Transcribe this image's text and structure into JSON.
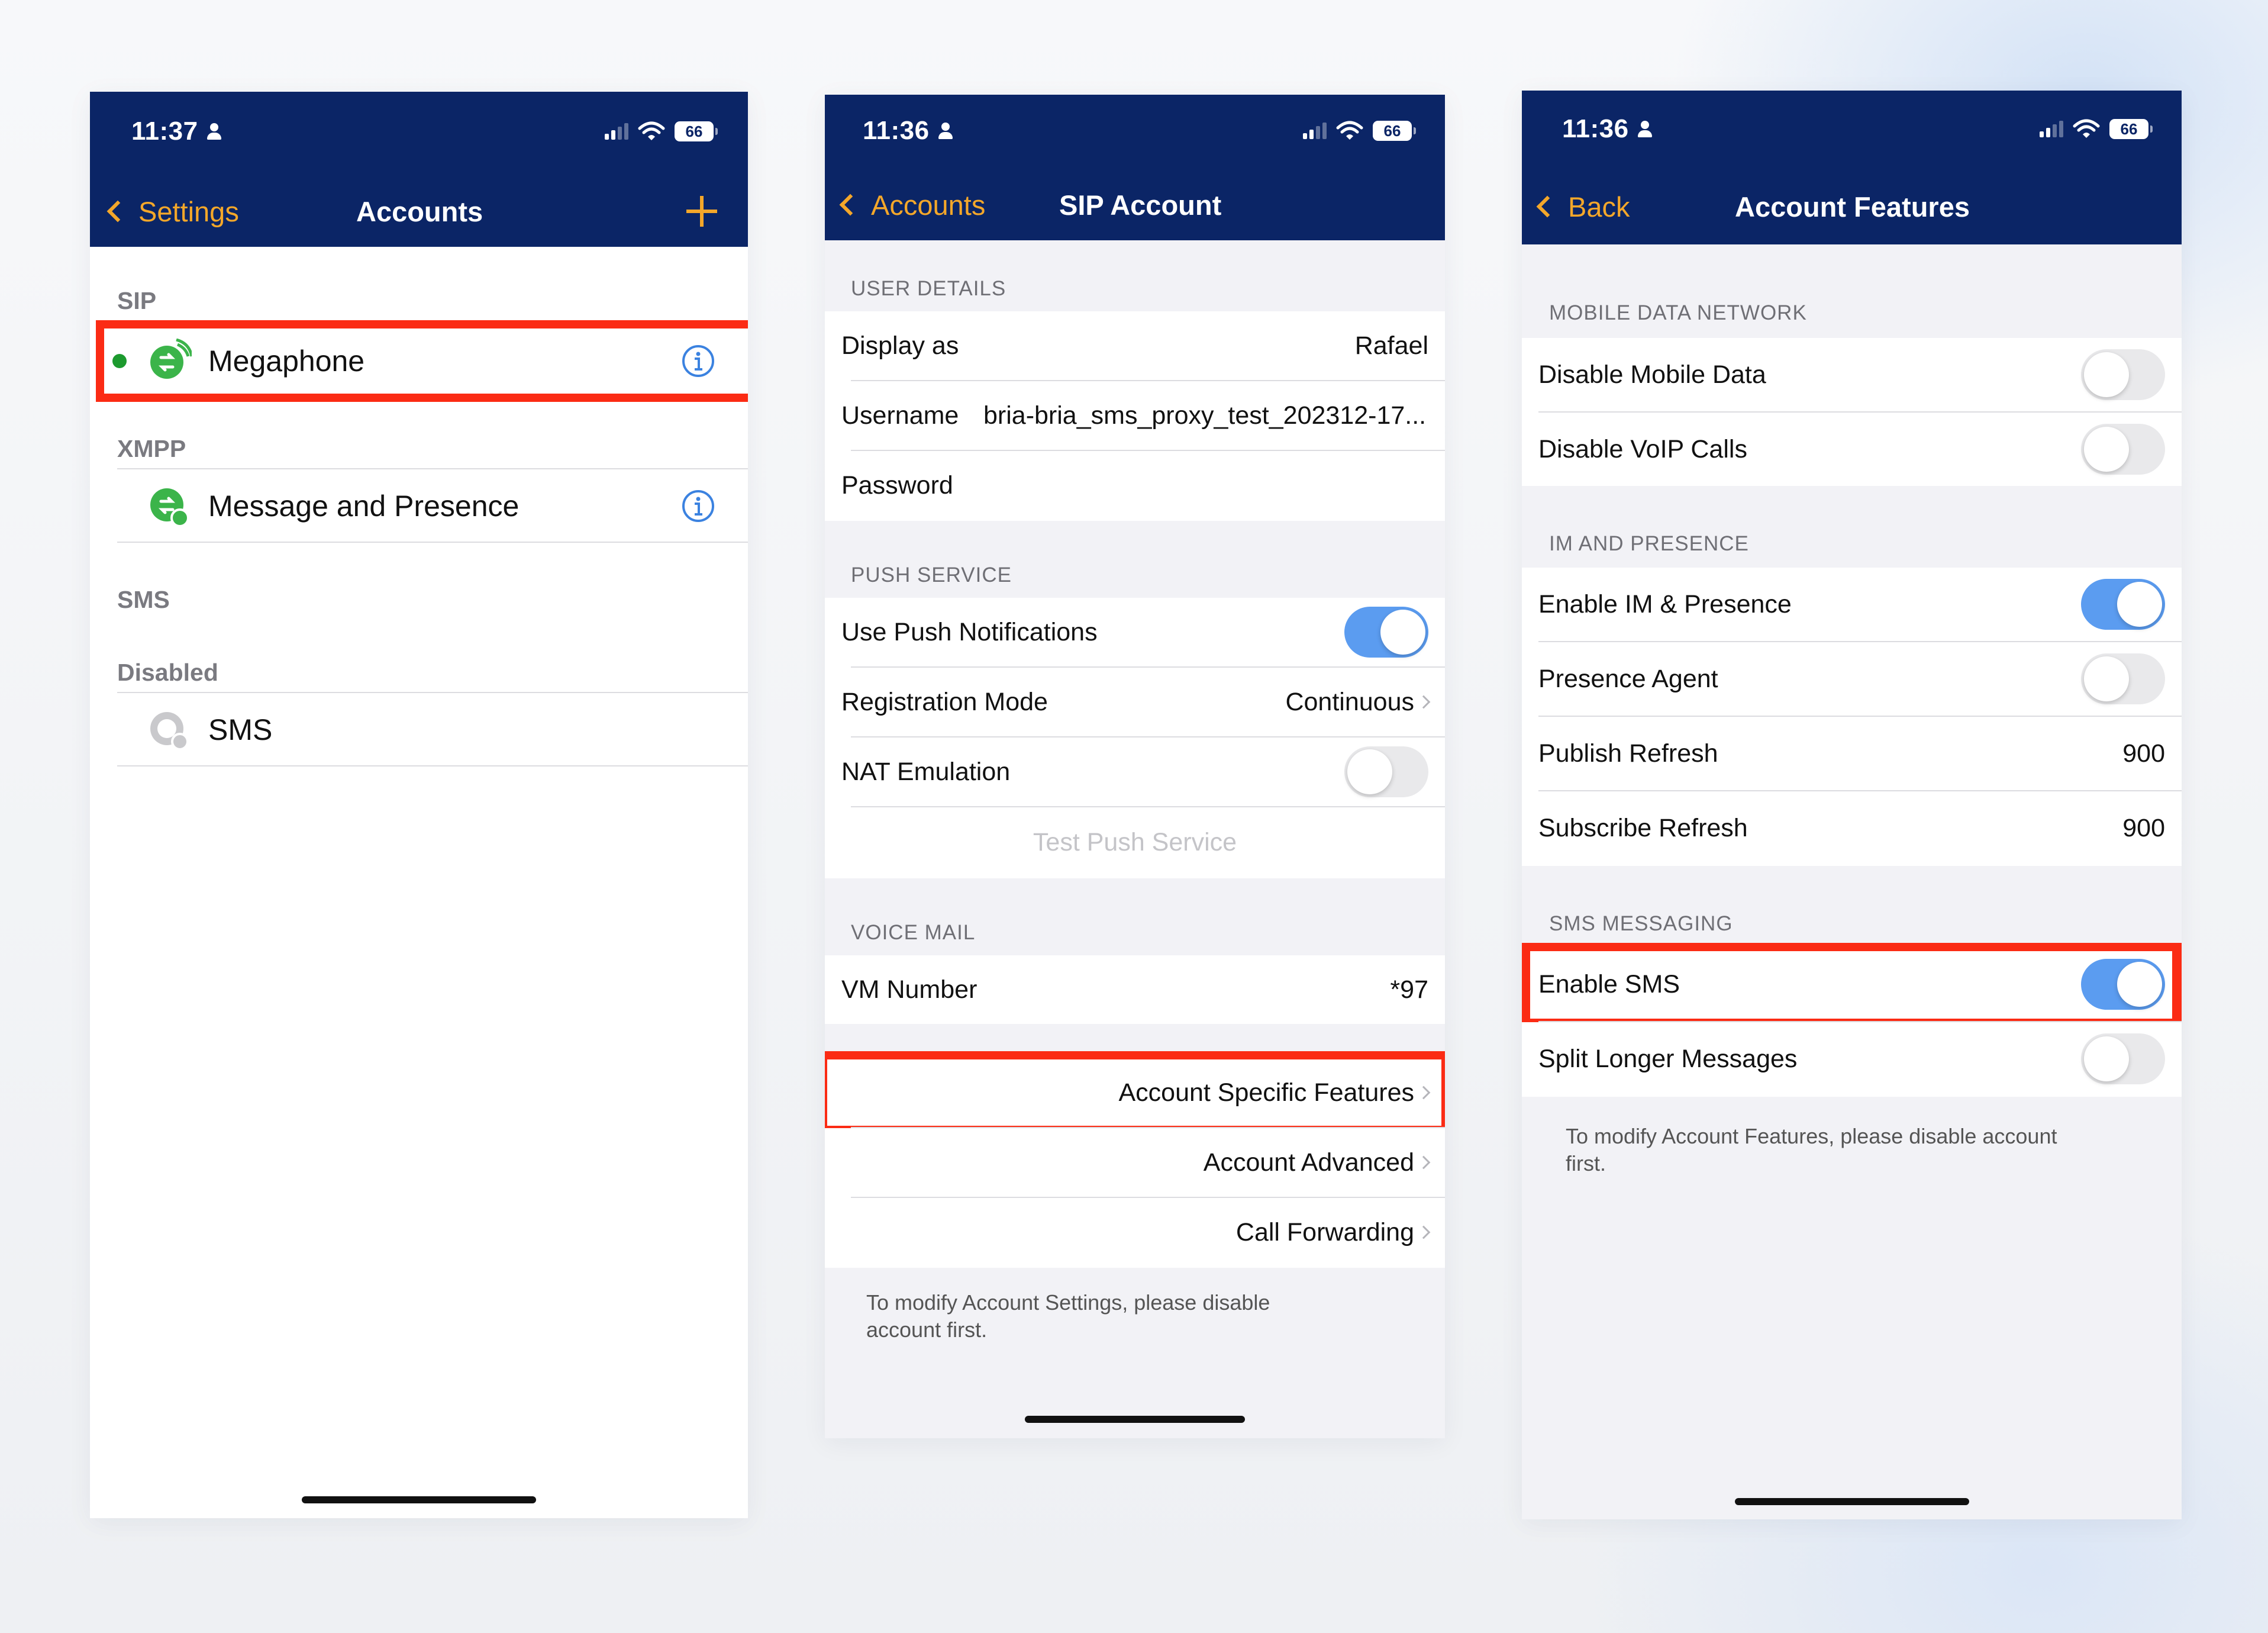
{
  "screen1": {
    "time": "11:37",
    "battery": "66",
    "back_label": "Settings",
    "title": "Accounts",
    "sections": {
      "sip": "SIP",
      "xmpp": "XMPP",
      "sms": "SMS",
      "disabled": "Disabled"
    },
    "accounts": {
      "megaphone": "Megaphone",
      "message_presence": "Message and Presence",
      "sms": "SMS"
    }
  },
  "screen2": {
    "time": "11:36",
    "battery": "66",
    "back_label": "Accounts",
    "title": "SIP Account",
    "user_details_header": "USER DETAILS",
    "display_as_label": "Display as",
    "display_as_value": "Rafael",
    "username_label": "Username",
    "username_value": "bria-bria_sms_proxy_test_202312-17...",
    "password_label": "Password",
    "push_service_header": "PUSH SERVICE",
    "use_push_label": "Use Push Notifications",
    "use_push_on": true,
    "registration_mode_label": "Registration Mode",
    "registration_mode_value": "Continuous",
    "nat_emulation_label": "NAT Emulation",
    "nat_emulation_on": false,
    "test_push_label": "Test Push Service",
    "voice_mail_header": "VOICE MAIL",
    "vm_number_label": "VM Number",
    "vm_number_value": "*97",
    "account_specific_label": "Account Specific Features",
    "account_advanced_label": "Account Advanced",
    "call_forwarding_label": "Call Forwarding",
    "footer": "To modify Account Settings, please disable account first."
  },
  "screen3": {
    "time": "11:36",
    "battery": "66",
    "back_label": "Back",
    "title": "Account Features",
    "mobile_data_header": "MOBILE DATA NETWORK",
    "disable_mobile_data_label": "Disable Mobile Data",
    "disable_mobile_data_on": false,
    "disable_voip_label": "Disable VoIP Calls",
    "disable_voip_on": false,
    "im_presence_header": "IM AND PRESENCE",
    "enable_im_label": "Enable IM & Presence",
    "enable_im_on": true,
    "presence_agent_label": "Presence Agent",
    "presence_agent_on": false,
    "publish_refresh_label": "Publish Refresh",
    "publish_refresh_value": "900",
    "subscribe_refresh_label": "Subscribe Refresh",
    "subscribe_refresh_value": "900",
    "sms_messaging_header": "SMS MESSAGING",
    "enable_sms_label": "Enable SMS",
    "enable_sms_on": true,
    "split_longer_label": "Split Longer Messages",
    "split_longer_on": false,
    "footer": "To modify Account Features, please disable account first."
  },
  "colors": {
    "nav_bar": "#0b2566",
    "accent": "#f4a72a",
    "toggle_on": "#5b9cf0",
    "highlight": "#fb2b14",
    "online_dot": "#1c9a2e"
  }
}
